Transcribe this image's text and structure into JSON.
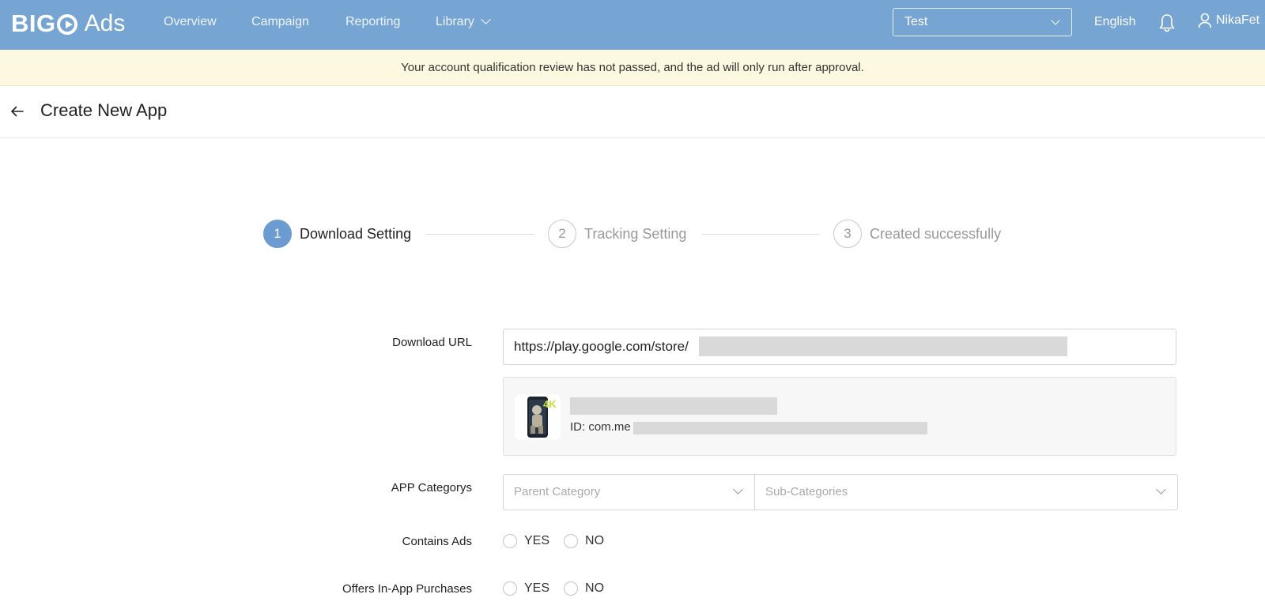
{
  "colors": {
    "topbar": "#76a5d3",
    "accent": "#6b9bd0",
    "notice_bg": "#fdf8e0"
  },
  "brand": {
    "bigo": "BIGO",
    "ads": "Ads"
  },
  "nav": {
    "items": [
      {
        "label": "Overview"
      },
      {
        "label": "Campaign"
      },
      {
        "label": "Reporting"
      },
      {
        "label": "Library"
      }
    ],
    "account": "Test",
    "language": "English",
    "user": "NikaFet"
  },
  "notice": "Your account qualification review has not passed, and the ad will only run after approval.",
  "page": {
    "title": "Create New App"
  },
  "steps": [
    {
      "number": "1",
      "label": "Download Setting",
      "active": true
    },
    {
      "number": "2",
      "label": "Tracking Setting",
      "active": false
    },
    {
      "number": "3",
      "label": "Created successfully",
      "active": false
    }
  ],
  "form": {
    "download_url_label": "Download URL",
    "download_url_value": "https://play.google.com/store/",
    "app_id_prefix": "ID: com.me",
    "categories_label": "APP Categorys",
    "parent_placeholder": "Parent Category",
    "sub_placeholder": "Sub-Categories",
    "contains_ads_label": "Contains Ads",
    "iap_label": "Offers In-App Purchases",
    "yes": "YES",
    "no": "NO"
  }
}
